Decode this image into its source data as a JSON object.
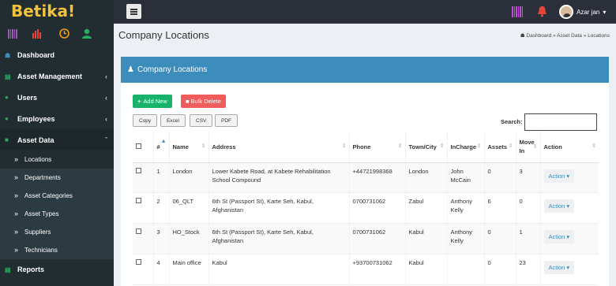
{
  "brand": {
    "name": "Betika!"
  },
  "topbar": {
    "user_name": "Azar jan",
    "user_caret": "▾"
  },
  "sidebar": {
    "items": [
      {
        "label": "Dashboard",
        "icon": "house-icon"
      },
      {
        "label": "Asset Management",
        "icon": "chart-icon"
      },
      {
        "label": "Users",
        "icon": "user-icon"
      },
      {
        "label": "Employees",
        "icon": "user-icon"
      },
      {
        "label": "Asset Data",
        "icon": "briefcase-icon"
      }
    ],
    "sub_items": [
      "Locations",
      "Departments",
      "Asset Categories",
      "Asset Types",
      "Suppliers",
      "Technicians"
    ],
    "reports": "Reports"
  },
  "page": {
    "title": "Company Locations",
    "breadcrumb": {
      "home": "Dashboard",
      "sep": "»",
      "b2": "Asset Data",
      "b3": "Locations"
    }
  },
  "box": {
    "title": "Company Locations",
    "add_label": "Add New",
    "delete_label": "Bulk Delete",
    "export": [
      "Copy",
      "Excel",
      "CSV",
      "PDF"
    ],
    "search_label": "Search:"
  },
  "table": {
    "headers": [
      "",
      "#",
      "Name",
      "Address",
      "Phone",
      "Town/City",
      "InCharge",
      "Assets",
      "Move In",
      "Action"
    ],
    "rows": [
      {
        "num": "1",
        "name": "London",
        "address": "Lower Kabete Road, at Kabete Rehabilitation School Compound",
        "phone": "+44721998368",
        "town": "London",
        "incharge": "John McCain",
        "assets": "0",
        "move": "3",
        "action": "Action ▾"
      },
      {
        "num": "2",
        "name": "06_QLT",
        "address": "6th St (Passport St), Karte Seh, Kabul, Afghanistan",
        "phone": "0700731062",
        "town": "Zabul",
        "incharge": "Anthony Kelly",
        "assets": "6",
        "move": "0",
        "action": "Action ▾"
      },
      {
        "num": "3",
        "name": "HO_Stock",
        "address": "6th St (Passport St), Karte Seh, Kabul, Afghanistan",
        "phone": "0700731062",
        "town": "Kabul",
        "incharge": "Anthony Kelly",
        "assets": "0",
        "move": "1",
        "action": "Action ▾"
      },
      {
        "num": "4",
        "name": "Main office",
        "address": "Kabul",
        "phone": "+93700731062",
        "town": "Kabul",
        "incharge": "",
        "assets": "0",
        "move": "23",
        "action": "Action ▾"
      }
    ]
  },
  "colors": {
    "header_blue": "#3c8dbc",
    "sidebar": "#222d32",
    "add": "#18b26b",
    "delete": "#f05c5c",
    "brand": "#f2c23a"
  }
}
